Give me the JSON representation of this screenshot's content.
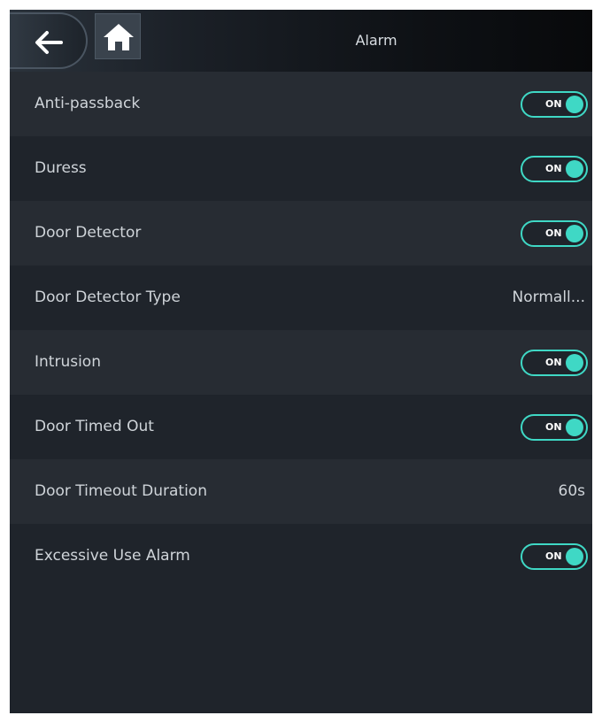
{
  "header": {
    "title": "Alarm",
    "back_icon": "arrow-left-icon",
    "home_icon": "home-icon"
  },
  "colors": {
    "accent": "#3fd8c5",
    "background": "#1f242b",
    "row_alt": "#272c33",
    "text": "#cfd4d9"
  },
  "settings": [
    {
      "label": "Anti-passback",
      "type": "toggle",
      "value": "ON"
    },
    {
      "label": "Duress",
      "type": "toggle",
      "value": "ON"
    },
    {
      "label": "Door Detector",
      "type": "toggle",
      "value": "ON"
    },
    {
      "label": "Door Detector Type",
      "type": "value",
      "value": "Normall..."
    },
    {
      "label": "Intrusion",
      "type": "toggle",
      "value": "ON"
    },
    {
      "label": "Door Timed Out",
      "type": "toggle",
      "value": "ON"
    },
    {
      "label": "Door Timeout Duration",
      "type": "value",
      "value": "60s"
    },
    {
      "label": "Excessive Use Alarm",
      "type": "toggle",
      "value": "ON"
    }
  ]
}
